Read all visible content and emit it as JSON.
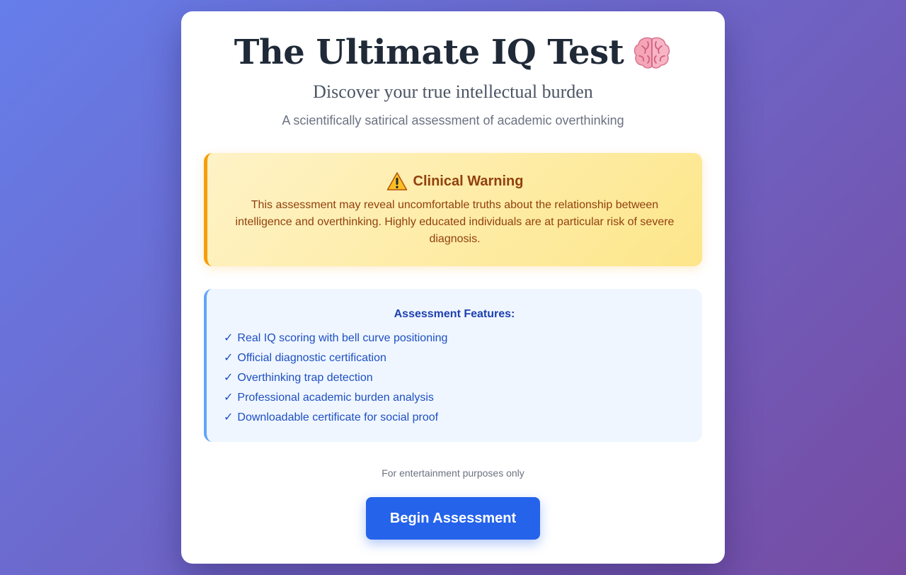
{
  "header": {
    "title": "The Ultimate IQ Test",
    "title_icon": "brain-icon",
    "subtitle": "Discover your true intellectual burden",
    "tagline": "A scientifically satirical assessment of academic overthinking"
  },
  "warning": {
    "icon": "warning-icon",
    "title": "Clinical Warning",
    "text": "This assessment may reveal uncomfortable truths about the relationship between intelligence and overthinking. Highly educated individuals are at particular risk of severe diagnosis."
  },
  "features": {
    "title": "Assessment Features:",
    "check": "✓",
    "items": [
      "Real IQ scoring with bell curve positioning",
      "Official diagnostic certification",
      "Overthinking trap detection",
      "Professional academic burden analysis",
      "Downloadable certificate for social proof"
    ]
  },
  "footer": {
    "disclaimer": "For entertainment purposes only",
    "button_label": "Begin Assessment"
  },
  "colors": {
    "background_start": "#667eea",
    "background_end": "#764ba2",
    "title": "#1f2937",
    "warning_text": "#92400e",
    "warning_border": "#f59e0b",
    "features_text": "#1e40af",
    "features_border": "#60a5fa",
    "button": "#2563eb"
  }
}
